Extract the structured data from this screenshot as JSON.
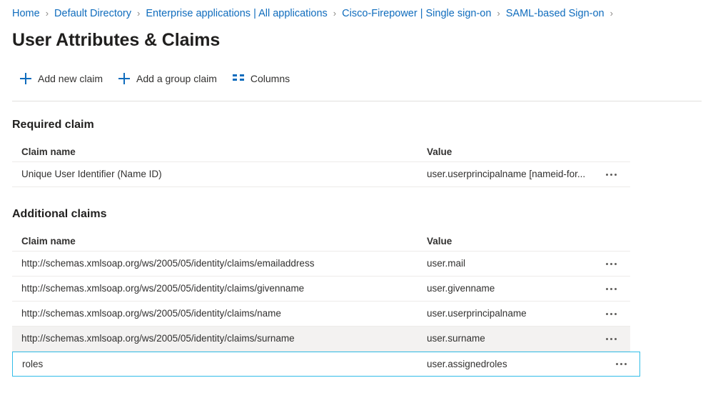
{
  "breadcrumb": {
    "separator": "›",
    "items": [
      {
        "label": "Home"
      },
      {
        "label": "Default Directory"
      },
      {
        "label": "Enterprise applications | All applications"
      },
      {
        "label": "Cisco-Firepower | Single sign-on"
      },
      {
        "label": "SAML-based Sign-on"
      }
    ]
  },
  "page": {
    "title": "User Attributes & Claims"
  },
  "toolbar": {
    "add_new_claim": "Add new claim",
    "add_group_claim": "Add a group claim",
    "columns": "Columns"
  },
  "required_section": {
    "title": "Required claim",
    "headers": {
      "name": "Claim name",
      "value": "Value"
    },
    "rows": [
      {
        "name": "Unique User Identifier (Name ID)",
        "value": "user.userprincipalname [nameid-for...",
        "state": "normal"
      }
    ]
  },
  "additional_section": {
    "title": "Additional claims",
    "headers": {
      "name": "Claim name",
      "value": "Value"
    },
    "rows": [
      {
        "name": "http://schemas.xmlsoap.org/ws/2005/05/identity/claims/emailaddress",
        "value": "user.mail",
        "state": "normal"
      },
      {
        "name": "http://schemas.xmlsoap.org/ws/2005/05/identity/claims/givenname",
        "value": "user.givenname",
        "state": "normal"
      },
      {
        "name": "http://schemas.xmlsoap.org/ws/2005/05/identity/claims/name",
        "value": "user.userprincipalname",
        "state": "normal"
      },
      {
        "name": "http://schemas.xmlsoap.org/ws/2005/05/identity/claims/surname",
        "value": "user.surname",
        "state": "hovered"
      },
      {
        "name": "roles",
        "value": "user.assignedroles",
        "state": "selected"
      }
    ]
  },
  "colors": {
    "link": "#0f6cbd",
    "selection_border": "#32bde8",
    "hover_row": "#f3f2f1",
    "divider": "#edebe9",
    "text": "#323130"
  }
}
